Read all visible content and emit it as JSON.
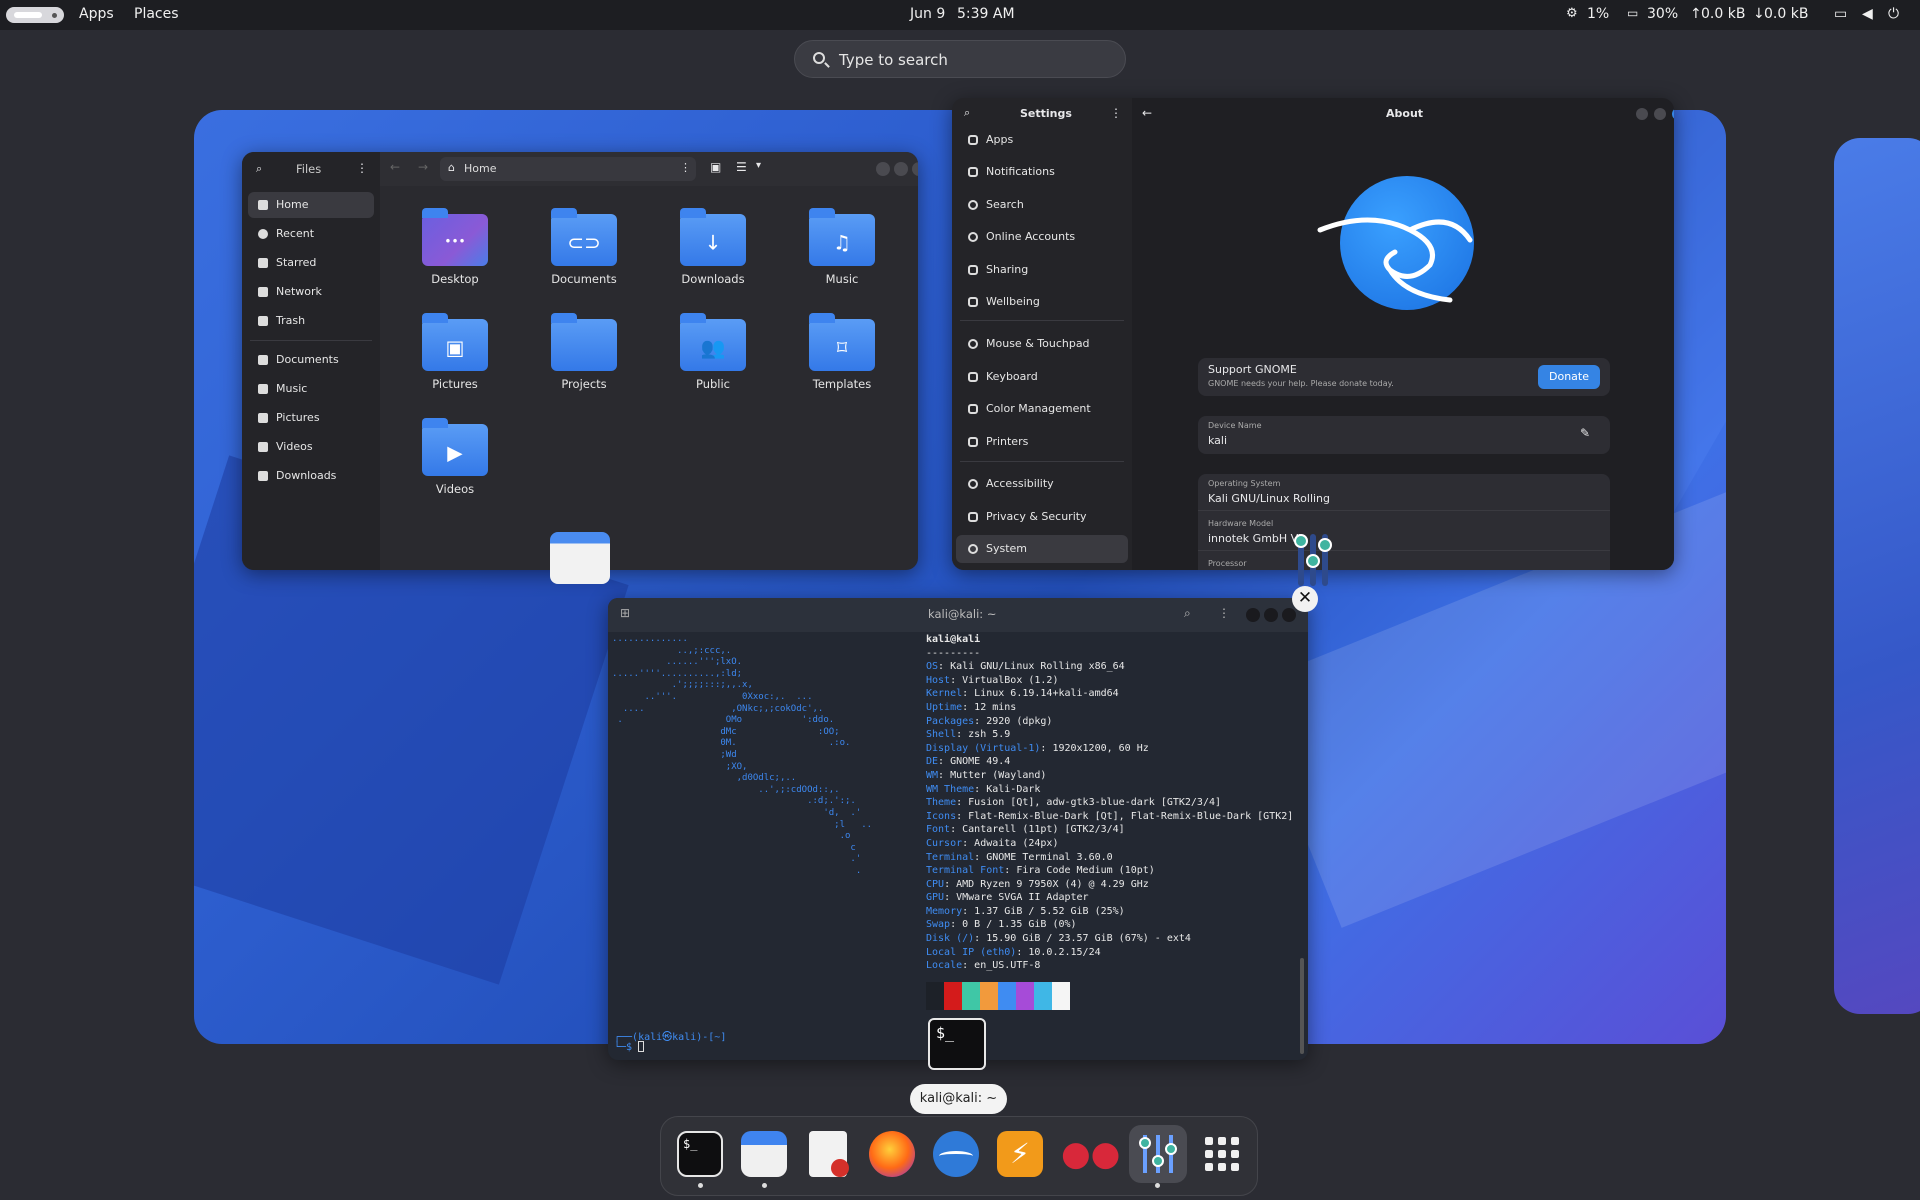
{
  "topbar": {
    "apps": "Apps",
    "places": "Places",
    "date": "Jun 9",
    "time": "5:39 AM",
    "cpu": "1%",
    "memory": "30%",
    "upload": "0.0 kB",
    "download": "0.0 kB"
  },
  "search": {
    "placeholder": "Type to search"
  },
  "files": {
    "title": "Files",
    "path": "Home",
    "sidebar": [
      "Home",
      "Recent",
      "Starred",
      "Network",
      "Trash",
      "Documents",
      "Music",
      "Pictures",
      "Videos",
      "Downloads"
    ],
    "folders": [
      "Desktop",
      "Documents",
      "Downloads",
      "Music",
      "Pictures",
      "Projects",
      "Public",
      "Templates",
      "Videos"
    ]
  },
  "settings": {
    "title": "Settings",
    "page": "About",
    "items": [
      "Apps",
      "Notifications",
      "Search",
      "Online Accounts",
      "Sharing",
      "Wellbeing",
      "Mouse & Touchpad",
      "Keyboard",
      "Color Management",
      "Printers",
      "Accessibility",
      "Privacy & Security",
      "System"
    ],
    "support_title": "Support GNOME",
    "support_sub": "GNOME needs your help. Please donate today.",
    "donate": "Donate",
    "device_label": "Device Name",
    "device_value": "kali",
    "os_label": "Operating System",
    "os_value": "Kali GNU/Linux Rolling",
    "hw_label": "Hardware Model",
    "hw_value": "innotek GmbH Vi",
    "proc_label": "Processor"
  },
  "terminal": {
    "title": "kali@kali: ~",
    "user": "kali@kali",
    "sep": "---------",
    "info": [
      [
        "OS",
        "Kali GNU/Linux Rolling x86_64"
      ],
      [
        "Host",
        "VirtualBox (1.2)"
      ],
      [
        "Kernel",
        "Linux 6.19.14+kali-amd64"
      ],
      [
        "Uptime",
        "12 mins"
      ],
      [
        "Packages",
        "2920 (dpkg)"
      ],
      [
        "Shell",
        "zsh 5.9"
      ],
      [
        "Display (Virtual-1)",
        "1920x1200, 60 Hz"
      ],
      [
        "DE",
        "GNOME 49.4"
      ],
      [
        "WM",
        "Mutter (Wayland)"
      ],
      [
        "WM Theme",
        "Kali-Dark"
      ],
      [
        "Theme",
        "Fusion [Qt], adw-gtk3-blue-dark [GTK2/3/4]"
      ],
      [
        "Icons",
        "Flat-Remix-Blue-Dark [Qt], Flat-Remix-Blue-Dark [GTK2]"
      ],
      [
        "Font",
        "Cantarell (11pt) [GTK2/3/4]"
      ],
      [
        "Cursor",
        "Adwaita (24px)"
      ],
      [
        "Terminal",
        "GNOME Terminal 3.60.0"
      ],
      [
        "Terminal Font",
        "Fira Code Medium (10pt)"
      ],
      [
        "CPU",
        "AMD Ryzen 9 7950X (4) @ 4.29 GHz"
      ],
      [
        "GPU",
        "VMware SVGA II Adapter"
      ],
      [
        "Memory",
        "1.37 GiB / 5.52 GiB (25%)"
      ],
      [
        "Swap",
        "0 B / 1.35 GiB (0%)"
      ],
      [
        "Disk (/)",
        "15.90 GiB / 23.57 GiB (67%) - ext4"
      ],
      [
        "Local IP (eth0)",
        "10.0.2.15/24"
      ],
      [
        "Locale",
        "en_US.UTF-8"
      ]
    ],
    "prompt": "┌──(kali㉿kali)-[~]",
    "prompt2": "└─$ ",
    "palette": [
      "#1d2128",
      "#d41b1b",
      "#3fc7a6",
      "#f29a3c",
      "#3f8cf2",
      "#a64bd8",
      "#3fb7e6",
      "#f5f5f5"
    ],
    "ascii": [
      "..............",
      "            ..,;:ccc,.",
      "          ......''';lxO.",
      ".....''''..........,:ld;",
      "           .';;;;:::;,,.x,",
      "      ..'''.            0Xxoc:,.  ...",
      "  ....                ,ONkc;,;cokOdc',.",
      " .                   OMo           ':ddo.",
      "                    dMc               :OO;",
      "                    0M.                 .:o.",
      "                    ;Wd",
      "                     ;XO,",
      "                       ,d0Odlc;,..",
      "                           ..',;:cdOOd::,.",
      "                                    .:d;.':;.",
      "                                       'd,  .'",
      "                                         ;l   ..",
      "                                          .o",
      "                                            c",
      "                                            .'",
      "                                             ."
    ]
  },
  "tooltip": "kali@kali: ~",
  "colors": {
    "accent": "#3584e4",
    "folder": "#3f84ef",
    "terminal_key": "#3f8cf2"
  }
}
